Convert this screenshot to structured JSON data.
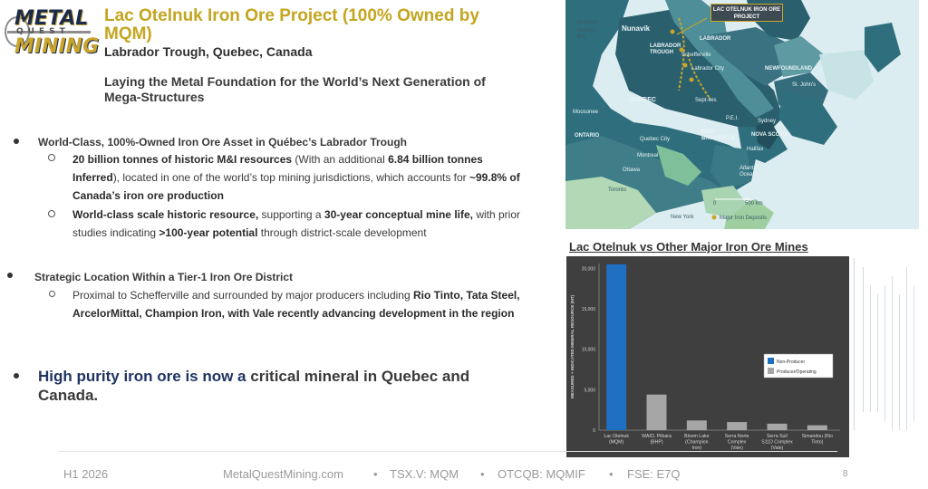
{
  "logo": {
    "line1": "METAL",
    "line2": "QUEST",
    "line3": "MINING"
  },
  "header": {
    "title": "Lac Otelnuk Iron Ore Project (100% Owned by MQM)",
    "subtitle": "Labrador Trough, Quebec, Canada",
    "tagline": "Laying the Metal Foundation for the World’s Next Generation of Mega-Structures"
  },
  "bullets": {
    "b1": "World-Class, 100%-Owned Iron Ore Asset in Québec’s Labrador Trough",
    "b1_sub1": {
      "p1": "20 billion tonnes of historic M&I resources",
      "p2": " (With an additional ",
      "p3": "6.84 billion tonnes Inferred",
      "p4": "), located in one of the world’s top mining jurisdictions, which accounts for ",
      "p5": "~99.8% of Canada’s iron ore production"
    },
    "b1_sub2": {
      "p1": "World-class scale historic resource,",
      "p2": " supporting a ",
      "p3": "30-year conceptual mine life,",
      "p4": " with prior studies indicating ",
      "p5": ">100-year potential",
      "p6": " through district-scale development"
    },
    "b2": "Strategic Location Within a Tier-1 Iron Ore District",
    "b2_sub1": {
      "p1": "Proximal to Schefferville and surrounded by major producers including ",
      "p2": "Rio Tinto, Tata Steel, ArcelorMittal, Champion Iron, with Vale recently advancing development in the region"
    },
    "b3": {
      "p1": "High purity iron ore is now a",
      "p2": " critical mineral in Quebec and Canada."
    }
  },
  "map": {
    "callout": "LAC OTELNUK IRON ORE PROJECT",
    "labels": {
      "inukjuak": "Inukjuak",
      "hudson": "Hudson Bay",
      "nunavik": "Nunavik",
      "labrador": "LABRADOR",
      "trough": "LABRADOR TROUGH",
      "schefferville": "Schefferville",
      "labrador_city": "Labrador City",
      "newfoundland": "NEWFOUNDLAND",
      "st_johns": "St. John's",
      "quebec": "QUEBEC",
      "moosonee": "Moosonee",
      "sept_iles": "Sept-Iles",
      "pei": "P.E.I.",
      "sydney": "Sydney",
      "ontario": "ONTARIO",
      "quebec_city": "Quebec City",
      "new_brunswick": "NEW BRUNSWICK",
      "nova_scotia": "NOVA SCOTIA",
      "halifax": "Halifax",
      "montreal": "Montreal",
      "ottawa": "Ottawa",
      "atlantic": "Atlantic Ocean",
      "toronto": "Toronto",
      "new_york": "New York",
      "scale_0": "0",
      "scale_500": "500 km",
      "legend": "Major Iron Deposits"
    }
  },
  "chart_data": {
    "type": "bar",
    "title": "Lac Otelnuk vs Other Major Iron Ore Mines",
    "ylabel": "MEASURED + INDICATED MINERAL RESOURCE (MT)",
    "ylim": [
      0,
      20000
    ],
    "yticks": [
      "0",
      "5,000",
      "10,000",
      "15,000",
      "20,000"
    ],
    "categories": [
      "Lac Otelnuk (MQM)",
      "WAIO, Pilbara (BHP)",
      "Bloom Lake (Champion Iron)",
      "Serra Norte Complex (Vale)",
      "Serra Sul/ S11D Complex (Vale)",
      "Simandou (Rio Tinto)"
    ],
    "category_lines": [
      [
        "Lac Otelnuk",
        "(MQM)"
      ],
      [
        "WAIO, Pilbara",
        "(BHP)"
      ],
      [
        "Bloom Lake",
        "(Champion",
        "Iron)"
      ],
      [
        "Serra Norte",
        "Complex",
        "(Vale)"
      ],
      [
        "Serra Sul/",
        "S11D Complex",
        "(Vale)"
      ],
      [
        "Simandou (Rio",
        "Tinto)"
      ]
    ],
    "values": [
      20500,
      4400,
      1200,
      1000,
      800,
      600
    ],
    "status": [
      "Non-Producer",
      "Producer/Operating",
      "Producer/Operating",
      "Producer/Operating",
      "Producer/Operating",
      "Producer/Operating"
    ],
    "legend": [
      {
        "name": "Non-Producer",
        "color": "#1f6fc2"
      },
      {
        "name": "Producer/Operating",
        "color": "#a6a6a6"
      }
    ],
    "legend_position": "right",
    "background": "#3f3f3f"
  },
  "footer": {
    "period": "H1 2026",
    "site": "MetalQuestMining.com",
    "tsxv": "TSX.V: MQM",
    "otcqb": "OTCQB: MQMIF",
    "fse": "FSE: E7Q",
    "sep": "•",
    "page": "8"
  }
}
